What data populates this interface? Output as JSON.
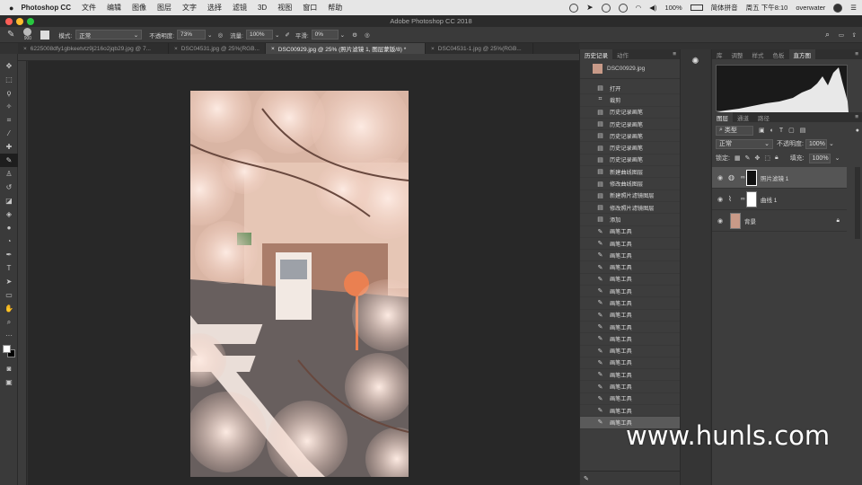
{
  "menubar": {
    "app": "Photoshop CC",
    "items": [
      "文件",
      "编辑",
      "图像",
      "图层",
      "文字",
      "选择",
      "滤镜",
      "3D",
      "视图",
      "窗口",
      "帮助"
    ],
    "battery": "100%",
    "input_method": "简体拼音",
    "clock": "周五 下午8:10",
    "user": "overwater"
  },
  "window": {
    "title": "Adobe Photoshop CC 2018"
  },
  "options": {
    "brush_size": "900",
    "mode_label": "模式:",
    "mode_value": "正常",
    "opacity_label": "不透明度:",
    "opacity_value": "73%",
    "flow_label": "流量:",
    "flow_value": "100%",
    "smooth_label": "平滑:",
    "smooth_value": "0%"
  },
  "tabs": [
    {
      "label": "6225008dfy1gbkeetvtz9j216o2jqb29.jpg @ 7...",
      "active": false
    },
    {
      "label": "DSC04531.jpg @ 25%(RGB...",
      "active": false
    },
    {
      "label": "DSC00929.jpg @ 25% (照片滤镜 1, 图层蒙版/8) *",
      "active": true
    },
    {
      "label": "DSC04531-1.jpg @ 25%(RGB...",
      "active": false
    }
  ],
  "history": {
    "tabs": [
      "历史记录",
      "动作"
    ],
    "snapshot": "DSC00929.jpg",
    "items": [
      {
        "label": "打开",
        "icon": "document-icon"
      },
      {
        "label": "裁剪",
        "icon": "crop-icon"
      },
      {
        "label": "历史记录画笔",
        "icon": "document-icon"
      },
      {
        "label": "历史记录画笔",
        "icon": "document-icon"
      },
      {
        "label": "历史记录画笔",
        "icon": "document-icon"
      },
      {
        "label": "历史记录画笔",
        "icon": "document-icon"
      },
      {
        "label": "历史记录画笔",
        "icon": "document-icon"
      },
      {
        "label": "新建曲线图层",
        "icon": "document-icon"
      },
      {
        "label": "修改曲线图层",
        "icon": "document-icon"
      },
      {
        "label": "新建照片滤镜图层",
        "icon": "document-icon"
      },
      {
        "label": "修改照片滤镜图层",
        "icon": "document-icon"
      },
      {
        "label": "添加",
        "icon": "document-icon"
      },
      {
        "label": "画笔工具",
        "icon": "brush-icon"
      },
      {
        "label": "画笔工具",
        "icon": "brush-icon"
      },
      {
        "label": "画笔工具",
        "icon": "brush-icon"
      },
      {
        "label": "画笔工具",
        "icon": "brush-icon"
      },
      {
        "label": "画笔工具",
        "icon": "brush-icon"
      },
      {
        "label": "画笔工具",
        "icon": "brush-icon"
      },
      {
        "label": "画笔工具",
        "icon": "brush-icon"
      },
      {
        "label": "画笔工具",
        "icon": "brush-icon"
      },
      {
        "label": "画笔工具",
        "icon": "brush-icon"
      },
      {
        "label": "画笔工具",
        "icon": "brush-icon"
      },
      {
        "label": "画笔工具",
        "icon": "brush-icon"
      },
      {
        "label": "画笔工具",
        "icon": "brush-icon"
      },
      {
        "label": "画笔工具",
        "icon": "brush-icon"
      },
      {
        "label": "画笔工具",
        "icon": "brush-icon"
      },
      {
        "label": "画笔工具",
        "icon": "brush-icon"
      },
      {
        "label": "画笔工具",
        "icon": "brush-icon"
      },
      {
        "label": "画笔工具",
        "icon": "brush-icon"
      }
    ],
    "selected_label": "画笔工具"
  },
  "right": {
    "top_tabs": [
      "库",
      "调整",
      "样式",
      "色板",
      "直方图"
    ],
    "layers_tabs": [
      "图层",
      "通道",
      "路径"
    ],
    "kind_label": "类型",
    "blend_mode": "正常",
    "opacity_label": "不透明度:",
    "opacity_value": "100%",
    "lock_label": "锁定:",
    "fill_label": "填充:",
    "fill_value": "100%",
    "layers": [
      {
        "name": "照片滤镜 1",
        "selected": true
      },
      {
        "name": "曲线 1",
        "selected": false
      },
      {
        "name": "背景",
        "selected": false
      }
    ]
  },
  "watermark": "www.hunls.com",
  "colors": {
    "accent": "#1473e6",
    "ui_dark": "#323232",
    "photo_tint": "#e8c3b3"
  }
}
